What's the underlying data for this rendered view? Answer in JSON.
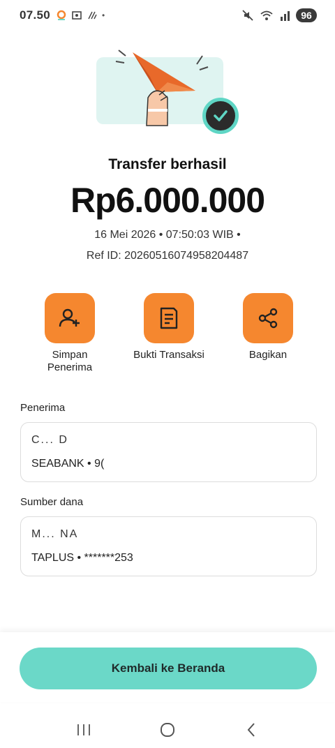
{
  "status_bar": {
    "time": "07.50",
    "battery": "96",
    "separator": "•"
  },
  "result": {
    "title": "Transfer berhasil",
    "amount": "Rp6.000.000",
    "datetime": "16 Mei 2026 • 07:50:03 WIB •",
    "ref_id": "Ref ID: 20260516074958204487"
  },
  "actions": [
    {
      "label": "Simpan Penerima",
      "icon": "add-user-icon"
    },
    {
      "label": "Bukti Transaksi",
      "icon": "receipt-icon"
    },
    {
      "label": "Bagikan",
      "icon": "share-icon"
    }
  ],
  "recipient": {
    "section_label": "Penerima",
    "name": "C...                               D",
    "account": "SEABANK • 9("
  },
  "source": {
    "section_label": "Sumber dana",
    "name": "M...                                  NA",
    "account": "TAPLUS • *******253"
  },
  "home_button": {
    "label": "Kembali ke Beranda"
  },
  "colors": {
    "accent_orange": "#f5872f",
    "accent_teal": "#6bd8c8",
    "hero_bg": "#dff4f1"
  }
}
